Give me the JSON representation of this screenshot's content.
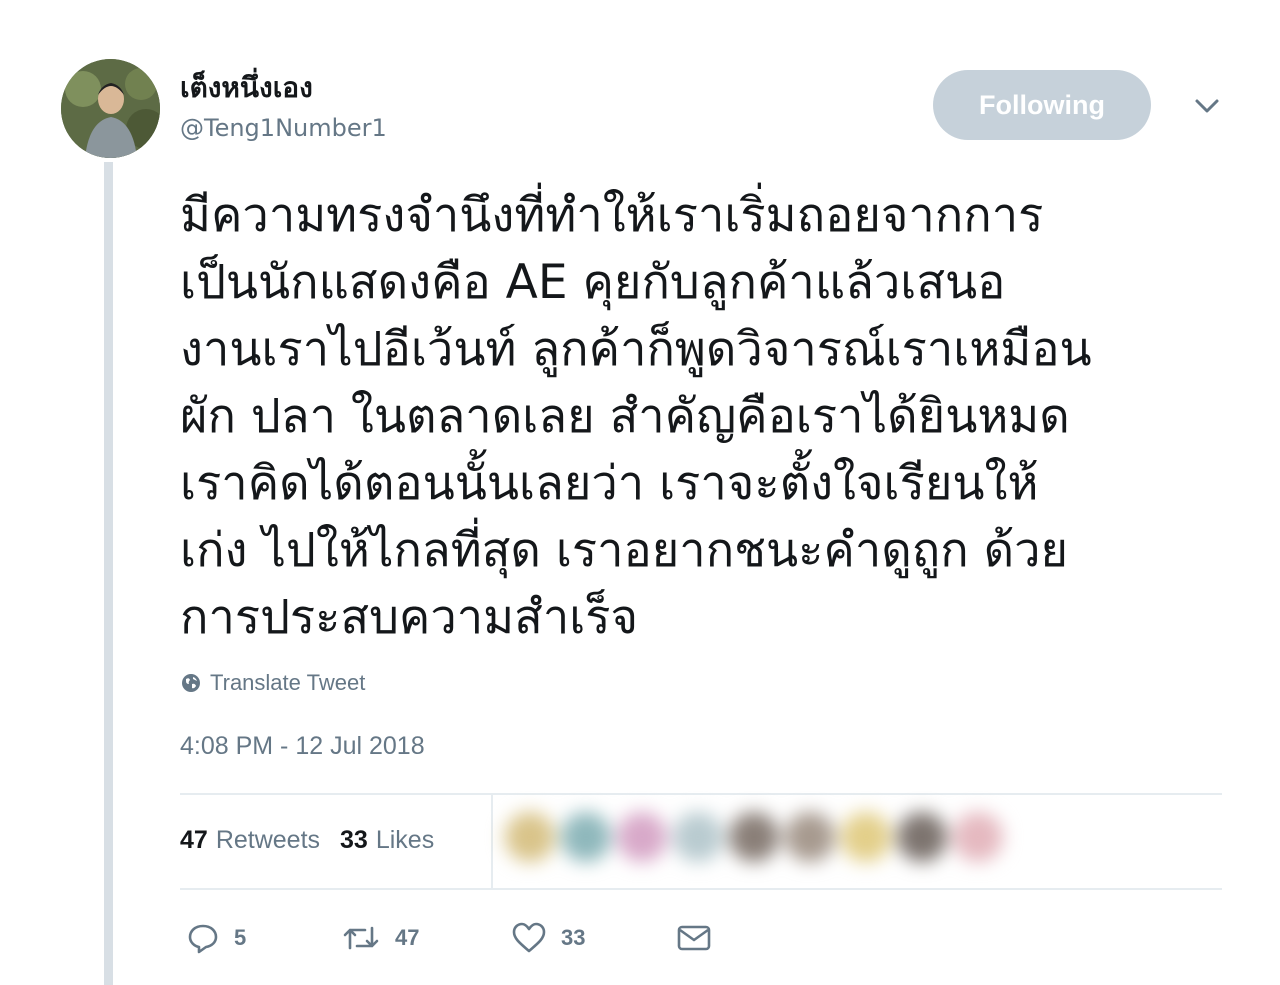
{
  "tweet": {
    "author": {
      "display_name": "เต็งหนึ่งเอง",
      "handle": "@Teng1Number1"
    },
    "follow_button_label": "Following",
    "text_lines": [
      "มีความทรงจำนึงที่ทำให้เราเริ่มถอยจากการ",
      "เป็นนักแสดงคือ AE คุยกับลูกค้าแล้วเสนอ",
      "งานเราไปอีเว้นท์ ลูกค้าก็พูดวิจารณ์เราเหมือน",
      "ผัก ปลา ในตลาดเลย สำคัญคือเราได้ยินหมด",
      "เราคิดได้ตอนนั้นเลยว่า เราจะตั้งใจเรียนให้",
      "เก่ง ไปให้ไกลที่สุด เราอยากชนะคำดูถูก ด้วย",
      "การประสบความสำเร็จ"
    ],
    "translate_label": "Translate Tweet",
    "timestamp": "4:08 PM - 12 Jul 2018",
    "stats": {
      "retweets_count": "47",
      "retweets_label": "Retweets",
      "likes_count": "33",
      "likes_label": "Likes"
    },
    "actions": {
      "replies": "5",
      "retweets": "47",
      "likes": "33"
    },
    "icons": {
      "caret": "chevron-down-icon",
      "translate": "globe-icon",
      "reply": "reply-icon",
      "retweet": "retweet-icon",
      "like": "heart-icon",
      "dm": "envelope-icon"
    },
    "colors": {
      "follow_button_bg": "#c6d1da",
      "muted_text": "#657786",
      "thread_line": "#d8dfe5"
    }
  }
}
